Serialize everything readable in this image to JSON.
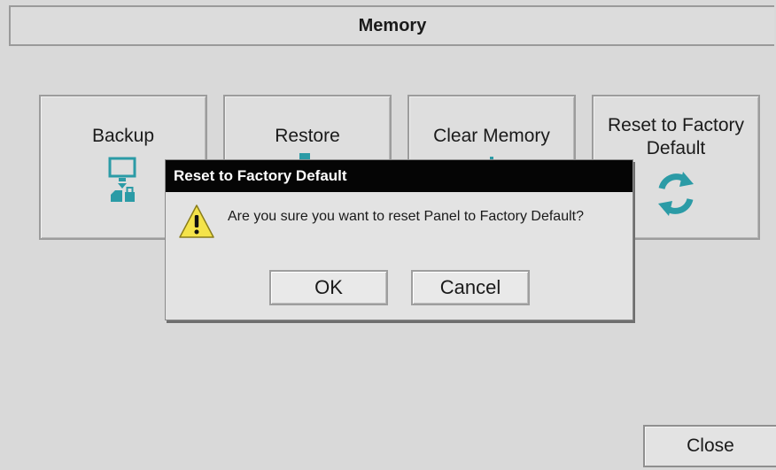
{
  "screen": {
    "title": "Memory",
    "colors": {
      "accent": "#2b9ba6",
      "background": "#d9d9d9",
      "dialog_titlebar": "#050505",
      "warning": "#f4e34a"
    }
  },
  "tiles": [
    {
      "label": "Backup",
      "icon": "backup-icon"
    },
    {
      "label": "Restore",
      "icon": "restore-icon"
    },
    {
      "label": "Clear Memory",
      "icon": "clear-memory-icon"
    },
    {
      "label": "Reset to Factory Default",
      "icon": "refresh-icon"
    }
  ],
  "dialog": {
    "title": "Reset to Factory Default",
    "message": "Are you sure you want to reset Panel to Factory Default?",
    "icon": "warning-icon",
    "ok_label": "OK",
    "cancel_label": "Cancel"
  },
  "footer": {
    "close_label": "Close"
  }
}
